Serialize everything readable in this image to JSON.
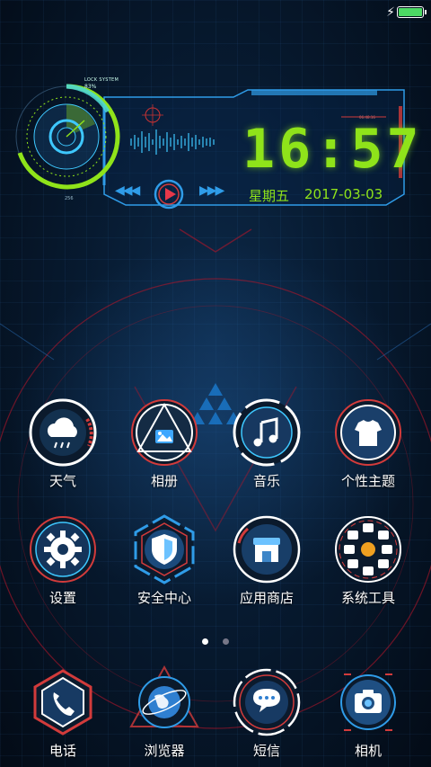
{
  "status_bar": {
    "charging_icon": "bolt-icon",
    "battery_color": "#4cd964",
    "battery_level": 1.0
  },
  "widget": {
    "lock_label": "LOCK SYSTEM",
    "lock_percent": "83%",
    "dial_number": "256",
    "small_label": "06:48:16",
    "time": "16:57",
    "weekday": "星期五",
    "date": "2017-03-03",
    "accent_color": "#8fe31a",
    "frame_color": "#2f9ce8"
  },
  "apps_page": [
    {
      "label": "天气",
      "icon": "weather-icon"
    },
    {
      "label": "相册",
      "icon": "gallery-icon"
    },
    {
      "label": "音乐",
      "icon": "music-icon"
    },
    {
      "label": "个性主题",
      "icon": "theme-icon"
    },
    {
      "label": "设置",
      "icon": "settings-icon"
    },
    {
      "label": "安全中心",
      "icon": "security-icon"
    },
    {
      "label": "应用商店",
      "icon": "app-store-icon"
    },
    {
      "label": "系统工具",
      "icon": "system-tools-icon"
    }
  ],
  "dock": [
    {
      "label": "电话",
      "icon": "phone-icon"
    },
    {
      "label": "浏览器",
      "icon": "browser-icon"
    },
    {
      "label": "短信",
      "icon": "messages-icon"
    },
    {
      "label": "相机",
      "icon": "camera-icon"
    }
  ],
  "pages": {
    "count": 2,
    "active": 0
  }
}
